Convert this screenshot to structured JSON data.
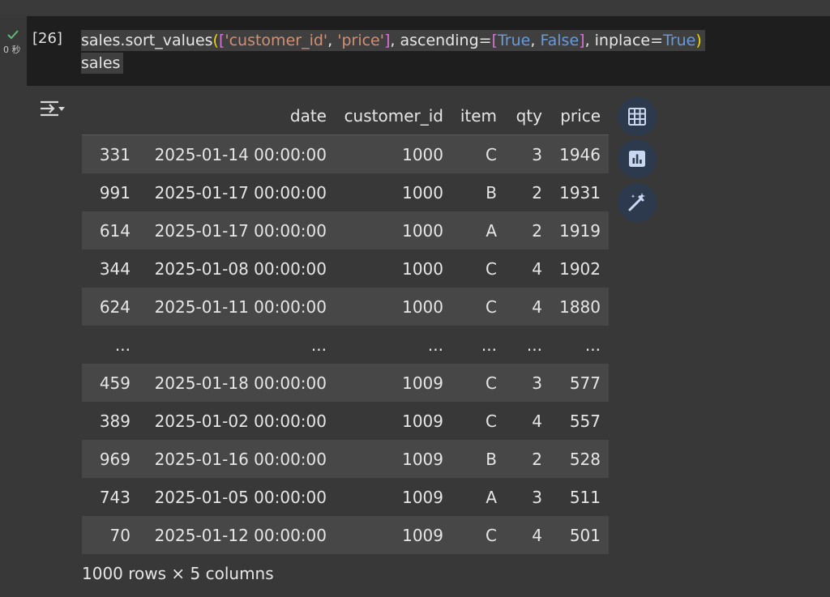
{
  "cell": {
    "status_icon": "check-icon",
    "exec_time": "0 秒",
    "exec_count": "[26]",
    "code": {
      "line1": {
        "t1": "sales.sort_values",
        "t2": "(",
        "t3": "[",
        "t4": "'customer_id'",
        "t5": ", ",
        "t6": "'price'",
        "t7": "]",
        "t8": ", ascending=",
        "t9": "[",
        "t10": "True",
        "t11": ", ",
        "t12": "False",
        "t13": "]",
        "t14": ", inplace=",
        "t15": "True",
        "t16": ")"
      },
      "line2": "sales"
    }
  },
  "output": {
    "icon": "output-toggle-icon",
    "table": {
      "columns": [
        "date",
        "customer_id",
        "item",
        "qty",
        "price"
      ],
      "rows": [
        {
          "index": "331",
          "date": "2025-01-14 00:00:00",
          "customer_id": "1000",
          "item": "C",
          "qty": "3",
          "price": "1946"
        },
        {
          "index": "991",
          "date": "2025-01-17 00:00:00",
          "customer_id": "1000",
          "item": "B",
          "qty": "2",
          "price": "1931"
        },
        {
          "index": "614",
          "date": "2025-01-17 00:00:00",
          "customer_id": "1000",
          "item": "A",
          "qty": "2",
          "price": "1919"
        },
        {
          "index": "344",
          "date": "2025-01-08 00:00:00",
          "customer_id": "1000",
          "item": "C",
          "qty": "4",
          "price": "1902"
        },
        {
          "index": "624",
          "date": "2025-01-11 00:00:00",
          "customer_id": "1000",
          "item": "C",
          "qty": "4",
          "price": "1880"
        },
        {
          "index": "...",
          "date": "...",
          "customer_id": "...",
          "item": "...",
          "qty": "...",
          "price": "..."
        },
        {
          "index": "459",
          "date": "2025-01-18 00:00:00",
          "customer_id": "1009",
          "item": "C",
          "qty": "3",
          "price": "577"
        },
        {
          "index": "389",
          "date": "2025-01-02 00:00:00",
          "customer_id": "1009",
          "item": "C",
          "qty": "4",
          "price": "557"
        },
        {
          "index": "969",
          "date": "2025-01-16 00:00:00",
          "customer_id": "1009",
          "item": "B",
          "qty": "2",
          "price": "528"
        },
        {
          "index": "743",
          "date": "2025-01-05 00:00:00",
          "customer_id": "1009",
          "item": "A",
          "qty": "3",
          "price": "511"
        },
        {
          "index": "70",
          "date": "2025-01-12 00:00:00",
          "customer_id": "1009",
          "item": "C",
          "qty": "4",
          "price": "501"
        }
      ]
    },
    "footer": "1000 rows × 5 columns",
    "actions": [
      "table-icon",
      "bar-chart-icon",
      "magic-wand-icon"
    ]
  },
  "colors": {
    "background": "#383838",
    "code_cell": "#1e1e1e",
    "row_shade": "#474747",
    "check": "#5fb878",
    "fab_bg": "#2d3a4e",
    "fab_icon": "#c9d8f0"
  }
}
